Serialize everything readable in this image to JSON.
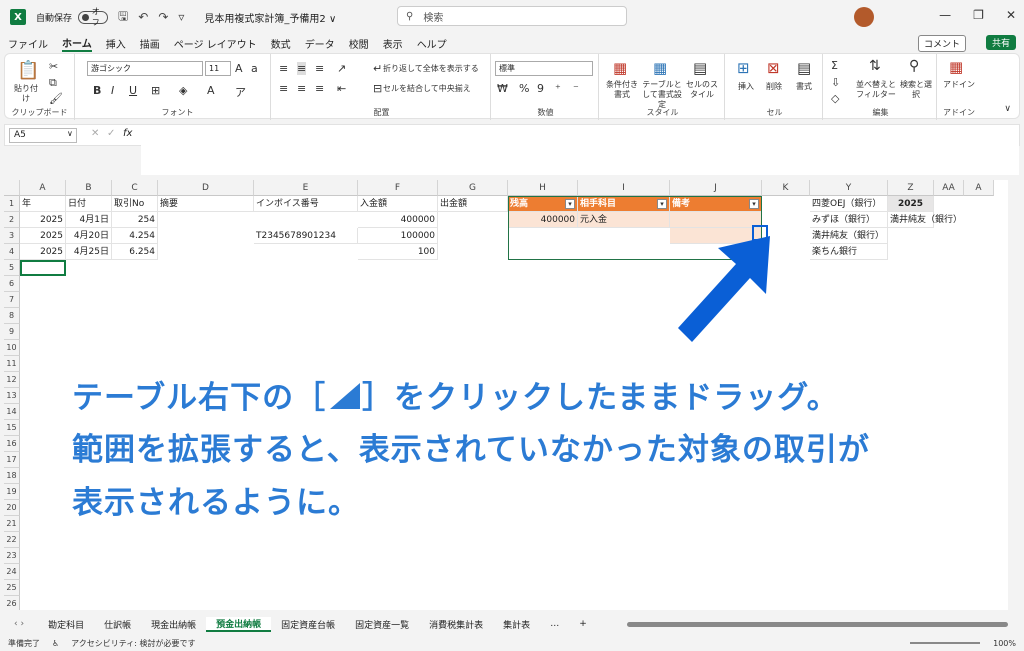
{
  "titlebar": {
    "logo": "X",
    "autosave_label": "自動保存",
    "autosave_state": "オフ",
    "doc_title": "見本用複式家計簿_予備用2 ∨",
    "search_placeholder": "検索"
  },
  "menu": [
    "ファイル",
    "ホーム",
    "挿入",
    "描画",
    "ページ レイアウト",
    "数式",
    "データ",
    "校閲",
    "表示",
    "ヘルプ"
  ],
  "menu_active": "ホーム",
  "comment_label": "コメント",
  "share_label": "共有",
  "ribbon": {
    "clipboard": {
      "paste": "貼り付け",
      "label": "クリップボード"
    },
    "font": {
      "name": "游ゴシック",
      "size": "11",
      "label": "フォント"
    },
    "alignment": {
      "wrap": "折り返して全体を表示する",
      "merge": "セルを結合して中央揃え",
      "label": "配置"
    },
    "number": {
      "format": "標準",
      "label": "数値"
    },
    "styles": {
      "cond": "条件付き書式",
      "table": "テーブルとして書式設定",
      "cell": "セルのスタイル",
      "label": "スタイル"
    },
    "cells": {
      "insert": "挿入",
      "delete": "削除",
      "format": "書式",
      "label": "セル"
    },
    "editing": {
      "sort": "並べ替えとフィルター",
      "find": "検索と選択",
      "label": "編集"
    },
    "addins": {
      "addin": "アドイン",
      "label": "アドイン"
    }
  },
  "formula": {
    "namebox": "A5",
    "fx": "fx"
  },
  "columns": [
    "A",
    "B",
    "C",
    "D",
    "E",
    "F",
    "G",
    "H",
    "I",
    "J",
    "K",
    "Y",
    "Z",
    "AA",
    "A"
  ],
  "rows": [
    "1",
    "2",
    "3",
    "4",
    "5",
    "6",
    "7",
    "8",
    "9",
    "10",
    "11",
    "12",
    "13",
    "14",
    "15",
    "16",
    "17",
    "18",
    "19",
    "20",
    "21",
    "22",
    "23",
    "24",
    "25",
    "26"
  ],
  "cells": {
    "a1": "年",
    "b1": "日付",
    "c1": "取引No",
    "d1": "摘要",
    "e1": "インボイス番号",
    "f1": "入金額",
    "g1": "出金額",
    "h1": "残高",
    "i1": "相手科目",
    "j1": "備考",
    "y1": "四菱OEJ（銀行）",
    "z1": "2025",
    "a2": "2025",
    "b2": "4月1日",
    "c2": "254",
    "f2": "400000",
    "h2": "400000",
    "i2": "元入金",
    "y2": "みずほ（銀行）",
    "z2": "満井純友（銀行）",
    "a3": "2025",
    "b3": "4月20日",
    "c3": "4.254",
    "e3": "T2345678901234",
    "f3": "100000",
    "y3": "満井純友（銀行）",
    "a4": "2025",
    "b4": "4月25日",
    "c4": "6.254",
    "f4": "100",
    "y4": "楽ちん銀行"
  },
  "annotation": {
    "line1a": "テーブル右下の［",
    "line1b": "］をクリックしたままドラッグ。",
    "line2": "範囲を拡張すると、表示されていなかった対象の取引が",
    "line3": "表示されるように。"
  },
  "sheets": [
    "勘定科目",
    "仕訳帳",
    "現金出納帳",
    "預金出納帳",
    "固定資産台帳",
    "固定資産一覧",
    "消費税集計表",
    "集計表"
  ],
  "active_sheet": "預金出納帳",
  "sheets_more": "…",
  "sheets_add": "+",
  "status": {
    "ready": "準備完了",
    "accessibility": "アクセシビリティ: 検討が必要です",
    "zoom": "100%"
  },
  "colors": {
    "accent": "#107c41",
    "table_header": "#ed7d31",
    "table_row": "#fbe4d5",
    "annotation": "#2b7bd4",
    "arrow": "#0a5fd6"
  }
}
